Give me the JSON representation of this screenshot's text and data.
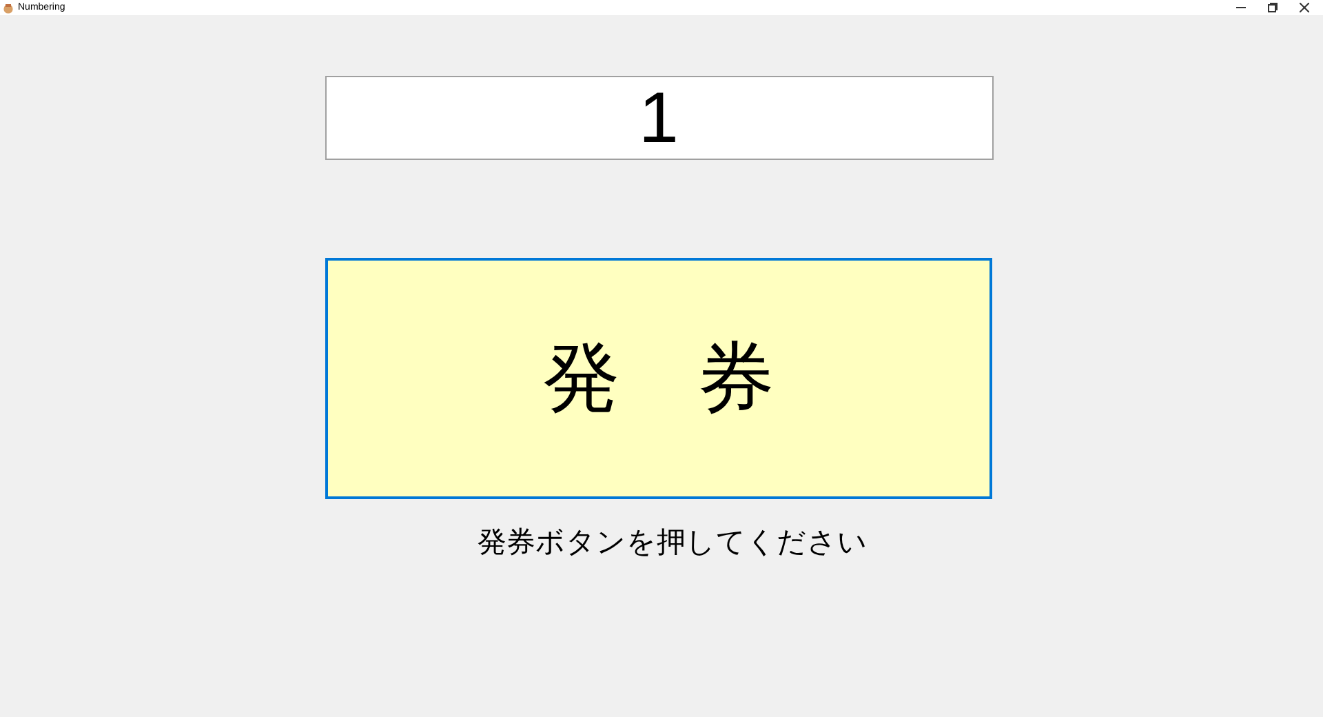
{
  "window": {
    "title": "Numbering"
  },
  "display": {
    "value": "1"
  },
  "issue_button": {
    "label": "発　券"
  },
  "instruction": "発券ボタンを押してください"
}
